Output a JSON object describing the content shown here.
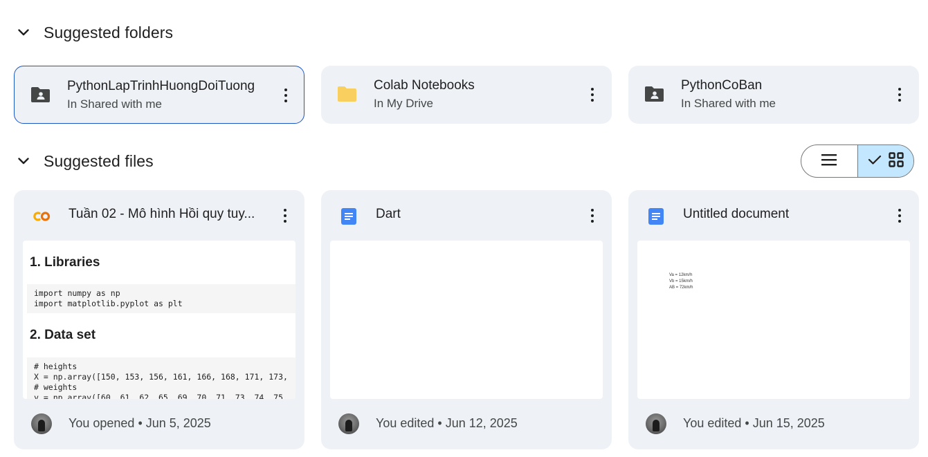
{
  "suggested_folders": {
    "title": "Suggested folders",
    "items": [
      {
        "name": "PythonLapTrinhHuongDoiTuong",
        "location": "In Shared with me",
        "icon": "shared-folder-icon"
      },
      {
        "name": "Colab Notebooks",
        "location": "In My Drive",
        "icon": "folder-icon"
      },
      {
        "name": "PythonCoBan",
        "location": "In Shared with me",
        "icon": "shared-folder-icon"
      }
    ]
  },
  "suggested_files": {
    "title": "Suggested files",
    "view_toggle": {
      "list_icon": "list-view-icon",
      "grid_icon": "grid-view-icon",
      "selected": "grid"
    },
    "items": [
      {
        "name": "Tuần 02 - Mô hình Hồi quy tuy...",
        "icon": "colab-icon",
        "activity": "You opened • Jun 5, 2025",
        "preview": {
          "heading1": "1. Libraries",
          "code1": "import numpy as np\nimport matplotlib.pyplot as plt",
          "heading2": "2. Data set",
          "code2": "# heights\nX = np.array([150, 153, 156, 161, 166, 168, 171, 173,\n# weights\ny = np.array([60, 61, 62, 65, 69, 70, 71, 73, 74, 75"
        }
      },
      {
        "name": "Dart",
        "icon": "google-docs-icon",
        "activity": "You edited • Jun 12, 2025"
      },
      {
        "name": "Untitled document",
        "icon": "google-docs-icon",
        "activity": "You edited • Jun 15, 2025",
        "preview": {
          "text": "Va = 12km/h\nVb = 15km/h\nAB = 72km/h"
        }
      }
    ]
  },
  "colors": {
    "card_bg": "#eef1f6",
    "selected_border": "#1a56c4",
    "toggle_selected": "#c2e7ff",
    "folder_yellow": "#f9cf5f",
    "docs_blue": "#4285f4",
    "colab_orange": "#f9ab00"
  }
}
